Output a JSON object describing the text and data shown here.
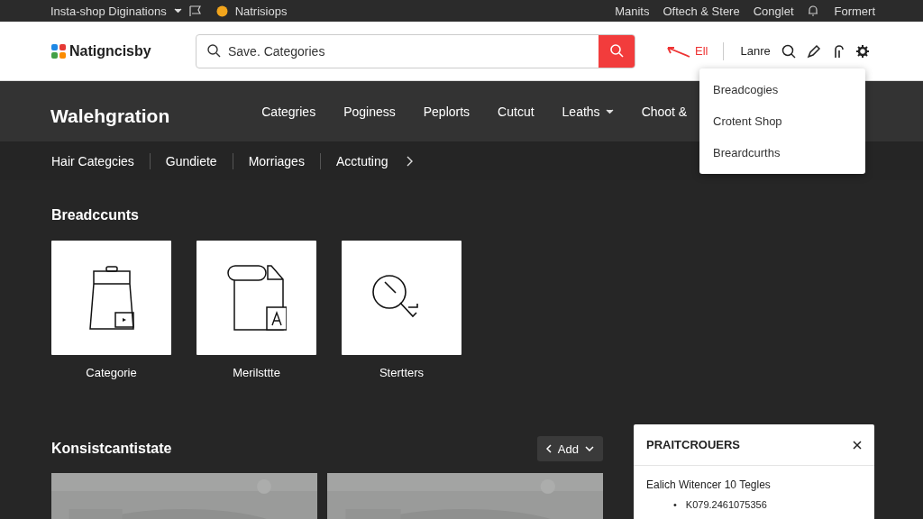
{
  "top_bar": {
    "left": [
      {
        "label": "Insta-shop Diginations",
        "kind": "dropdown"
      },
      {
        "label": "Natrisiops",
        "kind": "coin"
      }
    ],
    "right": [
      {
        "label": "Manits",
        "kind": "text"
      },
      {
        "label": "Oftech & Stere",
        "kind": "text"
      },
      {
        "label": "Conglet",
        "kind": "text"
      },
      {
        "label": "Formert",
        "kind": "bell"
      }
    ]
  },
  "header": {
    "logo": "Natigncisby",
    "search": {
      "value": "Save. Categories"
    },
    "alert": "Ell",
    "account": "Lanre"
  },
  "account_menu": {
    "items": [
      "Breadcogies",
      "Crotent Shop",
      "Breardcurths"
    ]
  },
  "nav": {
    "title": "Walehgration",
    "items": [
      {
        "label": "Categries",
        "has_menu": false
      },
      {
        "label": "Poginess",
        "has_menu": false
      },
      {
        "label": "Peplorts",
        "has_menu": false
      },
      {
        "label": "Cutcut",
        "has_menu": false
      },
      {
        "label": "Leaths",
        "has_menu": true
      },
      {
        "label": "Choot &",
        "has_menu": false
      }
    ]
  },
  "breadcrumbs": [
    "Hair Categcies",
    "Gundiete",
    "Morriages",
    "Acctuting"
  ],
  "section": {
    "title": "Breadccunts",
    "cards": [
      {
        "label": "Categorie",
        "kind": "bag"
      },
      {
        "label": "Merilsttte",
        "kind": "document"
      },
      {
        "label": "Stertters",
        "kind": "magnifier"
      }
    ]
  },
  "bottom": {
    "title": "Konsistcantistate",
    "button": "Add"
  },
  "panel": {
    "title": "PRAITCROUERS",
    "text": "Ealich Witencer 10 Tegles",
    "list": [
      {
        "bullet": "•",
        "text": "K079.2461075356"
      }
    ]
  }
}
